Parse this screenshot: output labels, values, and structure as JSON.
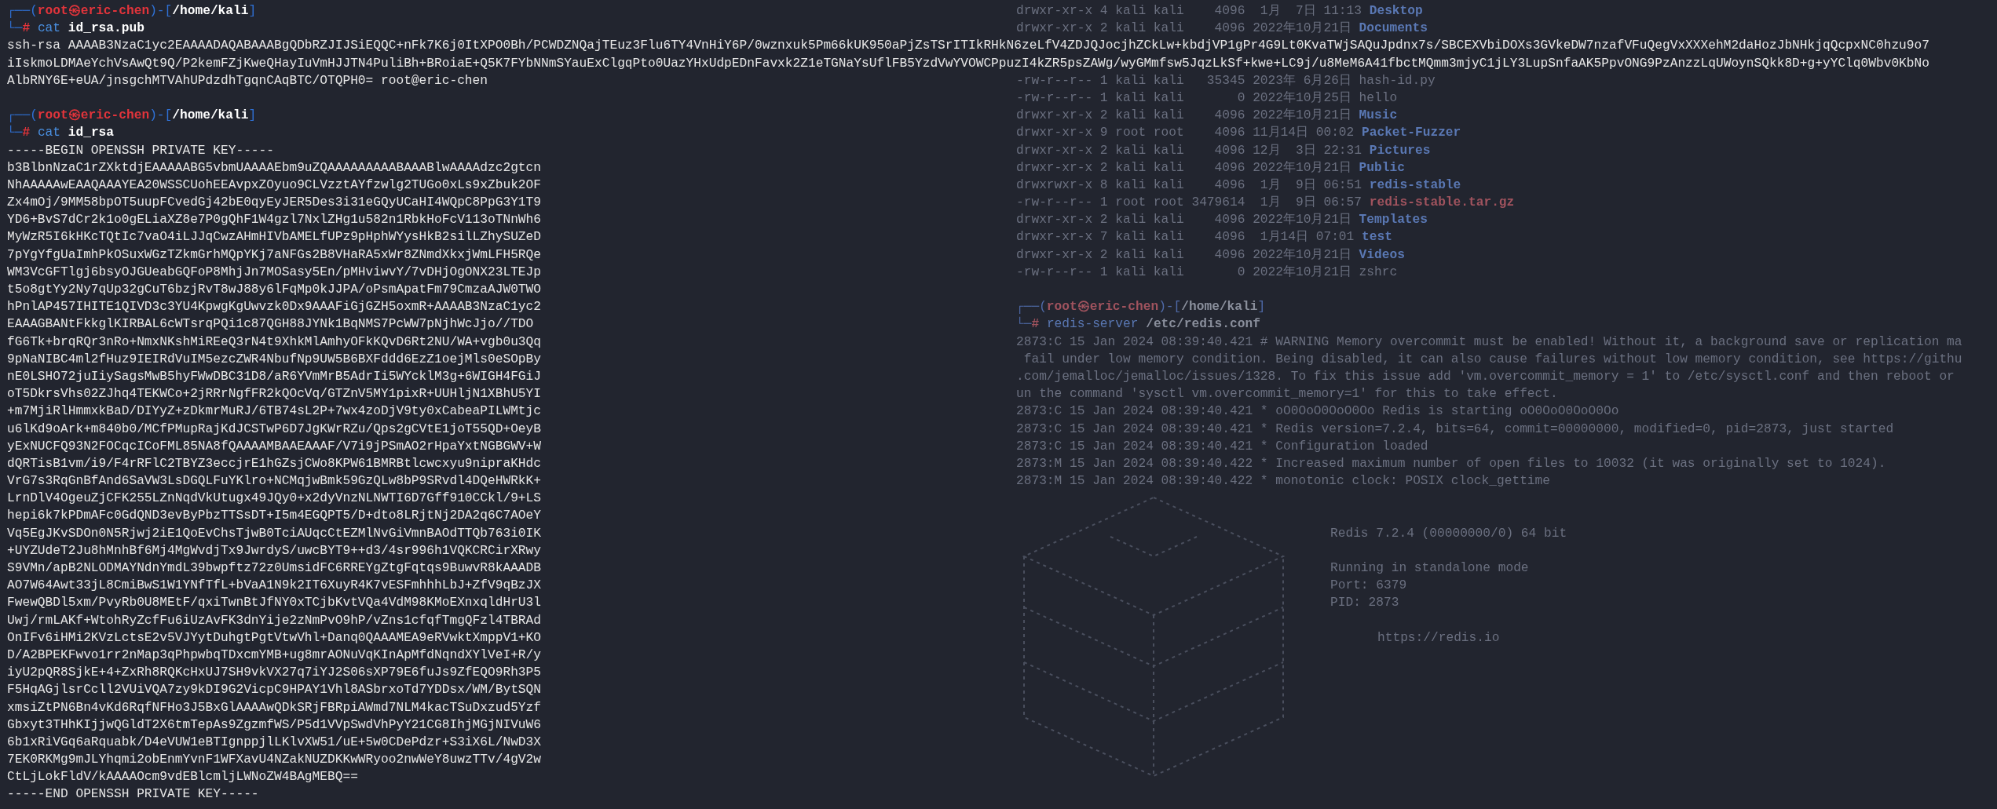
{
  "terminal": {
    "sessions": [
      {
        "prompt": {
          "frame_open": "┌──(",
          "user_host": "root㉿eric-chen",
          "frame_mid": ")-[",
          "path": "/home/kali",
          "frame_close": "]",
          "corner": "└─",
          "symbol": "#"
        },
        "command": {
          "program": "cat",
          "argument": "id_rsa.pub"
        },
        "output": [
          "ssh-rsa AAAAB3NzaC1yc2EAAAADAQABAAABgQDbRZJIJSiEQQC+nFk7K6j0ItXPO0Bh/PCWDZNQajTEuz3Flu6TY4VnHiY6P/0wznxuk5Pm66kUK950aPjZsTSrITIkRHkN6zeLfV4ZDJQJocjhZCkLw+kbdjVP1gPr4G9Lt0KvaTWjSAQuJpdnx7s/SBCEXVbiDOXs3GVkeDW7nzafVFuQegVxXXXehM2daHozJbNHkjqQcpxNC0hzu9o7",
          "iIskmoLDMAeYchVsAwQt9Q/P2kemFZjKweQHayIuVmHJJTN4PuliBh+BRoiaE+Q5K7FYbNNmSYauExClgqPto0UazYHxUdpEDnFavxk2Z1eTGNaYsUflFB5YzdVwYVOWCPpuzI4kZR5psZAWg/wyGMmfsw5JqzLkSf+kwe+LC9j/u8MeM6A41fbctMQmm3mjyC1jLY3LupSnfaAK5PpvONG9PzAnzzLqUWoynSQkk8D+g+yYClq0Wbv0KbNo",
          "AlbRNY6E+eUA/jnsgchMTVAhUPdzdhTgqnCAqBTC/OTQPH0= root@eric-chen"
        ]
      },
      {
        "prompt": {
          "frame_open": "┌──(",
          "user_host": "root㉿eric-chen",
          "frame_mid": ")-[",
          "path": "/home/kali",
          "frame_close": "]",
          "corner": "└─",
          "symbol": "#"
        },
        "command": {
          "program": "cat",
          "argument": "id_rsa"
        },
        "output": [
          "-----BEGIN OPENSSH PRIVATE KEY-----",
          "b3BlbnNzaC1rZXktdjEAAAAABG5vbmUAAAAEbm9uZQAAAAAAAAABAAABlwAAAAdzc2gtcn",
          "NhAAAAAwEAAQAAAYEA20WSSCUohEEAvpxZOyuo9CLVzztAYfzwlg2TUGo0xLs9xZbuk2OF",
          "Zx4mOj/9MM58bpOT5uupFCvedGj42bE0qyEyJER5Des3i31eGQyUCaHI4WQpC8PpG3Y1T9",
          "YD6+BvS7dCr2k1o0gELiaXZ8e7P0gQhF1W4gzl7NxlZHg1u582n1RbkHoFcV113oTNnWh6",
          "MyWzR5I6kHKcTQtIc7vaO4iLJJqCwzAHmHIVbAMELfUPz9pHphWYysHkB2silLZhySUZeD",
          "7pYgYfgUaImhPkOSuxWGzTZkmGrhMQpYKj7aNFGs2B8VHaRA5xWr8ZNmdXkxjWmLFH5RQe",
          "WM3VcGFTlgj6bsyOJGUeabGQFoP8MhjJn7MOSasy5En/pMHviwvY/7vDHjOgONX23LTEJp",
          "t5o8gtYy2Ny7qUp32gCuT6bzjRvT8wJ88y6lFqMp0kJJPA/oPsmApatFm79CmzaAJW0TWO",
          "hPnlAP457IHITE1QIVD3c3YU4KpwgKgUwvzk0Dx9AAAFiGjGZH5oxmR+AAAAB3NzaC1yc2",
          "EAAAGBANtFkkglKIRBAL6cWTsrqPQi1c87QGH88JYNk1BqNMS7PcWW7pNjhWcJjo//TDO",
          "fG6Tk+brqRQr3nRo+NmxNKshMiREeQ3rN4t9XhkMlAmhyOFkKQvD6Rt2NU/WA+vgb0u3Qq",
          "9pNaNIBC4ml2fHuz9IEIRdVuIM5ezcZWR4NbufNp9UW5B6BXFddd6EzZ1oejMls0eSOpBy",
          "nE0LSHO72juIiySagsMwB5hyFWwDBC31D8/aR6YVmMrB5AdrIi5WYcklM3g+6WIGH4FGiJ",
          "oT5DkrsVhs02ZJhq4TEKWCo+2jRRrNgfFR2kQOcVq/GTZnV5MY1pixR+UUHljN1XBhU5YI",
          "+m7MjiRlHmmxkBaD/DIYyZ+zDkmrMuRJ/6TB74sL2P+7wx4zoDjV9ty0xCabeaPILWMtjc",
          "u6lKd9oArk+m840b0/MCfPMupRajKdJCSTwP6D7JgKWrRZu/Qps2gCVtE1joT55QD+OeyB",
          "yExNUCFQ93N2FOCqcICoFML85NA8fQAAAAMBAAEAAAF/V7i9jPSmAO2rHpaYxtNGBGWV+W",
          "dQRTisB1vm/i9/F4rRFlC2TBYZ3eccjrE1hGZsjCWo8KPW61BMRBtlcwcxyu9nipraKHdc",
          "VrG7s3RqGnBfAnd6SaVW3LsDGQLFuYKlro+NCMqjwBmk59GzQLw8bP9SRvdl4DQeHWRkK+",
          "LrnDlV4OgeuZjCFK255LZnNqdVkUtugx49JQy0+x2dyVnzNLNWTI6D7Gff910CCkl/9+LS",
          "hepi6k7kPDmAFc0GdQND3evByPbzTTSsDT+I5m4EGQPT5/D+dto8LRjtNj2DA2q6C7AOeY",
          "Vq5EgJKvSDOn0N5Rjwj2iE1QoEvChsTjwB0TciAUqcCtEZMlNvGiVmnBAOdTTQb763i0IK",
          "+UYZUdeT2Ju8hMnhBf6Mj4MgWvdjTx9JwrdyS/uwcBYT9++d3/4sr996h1VQKCRCirXRwy",
          "S9VMn/apB2NLODMAYNdnYmdL39bwpftz72z0UmsidFC6RREYgZtgFqtqs9BuwvR8kAAADB",
          "AO7W64Awt33jL8CmiBwS1W1YNfTfL+bVaA1N9k2IT6XuyR4K7vESFmhhhLbJ+ZfV9qBzJX",
          "FwewQBDl5xm/PvyRb0U8MEtF/qxiTwnBtJfNY0xTCjbKvtVQa4VdM98KMoEXnxqldHrU3l",
          "Uwj/rmLAKf+WtohRyZcfFu6iUzAvFK3dnYije2zNmPvO9hP/vZns1cfqfTmgQFzl4TBRAd",
          "OnIFv6iHMi2KVzLctsE2v5VJYytDuhgtPgtVtwVhl+Danq0QAAAMEA9eRVwktXmppV1+KO",
          "D/A2BPEKFwvo1rr2nMap3qPhpwbqTDxcmYMB+ug8mrAONuVqKInApMfdNqndXYlVeI+R/y",
          "iyU2pQR8SjkE+4+ZxRh8RQKcHxUJ7SH9vkVX27q7iYJ2S06sXP79E6fuJs9ZfEQO9Rh3P5",
          "F5HqAGjlsrCcll2VUiVQA7zy9kDI9G2VicpC9HPAY1Vhl8ASbrxoTd7YDDsx/WM/BytSQN",
          "xmsiZtPN6Bn4vKd6RqfNFHo3J5BxGlAAAAwQDkSRjFBRpiAWmd7NLM4kacTSuDxzud5Yzf",
          "Gbxyt3THhKIjjwQGldT2X6tmTepAs9ZgzmfWS/P5d1VVpSwdVhPyY21CG8IhjMGjNIVuW6",
          "6b1xRiVGq6aRquabk/D4eVUW1eBTIgnppjlLKlvXW51/uE+5w0CDePdzr+S3iX6L/NwD3X",
          "7EK0RKMg9mJLYhqmi2obEnmYvnF1WFXavU4NZakNUZDKKwWRyoo2nwWeY8uwzTTv/4gV2w",
          "CtLjLokFldV/kAAAAOcm9vdEBlcmljLWNoZW4BAgMEBQ==",
          "-----END OPENSSH PRIVATE KEY-----"
        ]
      }
    ]
  },
  "background_window": {
    "listing_top": [
      {
        "info": "drwxr-xr-x 4 kali kali    4096  1月  7日 11:13",
        "name": "Desktop",
        "kind": "dir"
      },
      {
        "info": "drwxr-xr-x 2 kali kali    4096 2022年10月21日",
        "name": "Documents",
        "kind": "dir"
      }
    ],
    "listing_rest": [
      {
        "info": "-rw-r--r-- 1 kali kali   35345 2023年 6月26日",
        "name": "hash-id.py",
        "kind": "file"
      },
      {
        "info": "-rw-r--r-- 1 kali kali       0 2022年10月25日",
        "name": "hello",
        "kind": "file"
      },
      {
        "info": "drwxr-xr-x 2 kali kali    4096 2022年10月21日",
        "name": "Music",
        "kind": "dir"
      },
      {
        "info": "drwxr-xr-x 9 root root    4096 11月14日 00:02",
        "name": "Packet-Fuzzer",
        "kind": "dir"
      },
      {
        "info": "drwxr-xr-x 2 kali kali    4096 12月  3日 22:31",
        "name": "Pictures",
        "kind": "dir"
      },
      {
        "info": "drwxr-xr-x 2 kali kali    4096 2022年10月21日",
        "name": "Public",
        "kind": "dir"
      },
      {
        "info": "drwxrwxr-x 8 kali kali    4096  1月  9日 06:51",
        "name": "redis-stable",
        "kind": "dir"
      },
      {
        "info": "-rw-r--r-- 1 root root 3479614  1月  9日 06:57",
        "name": "redis-stable.tar.gz",
        "kind": "archive"
      },
      {
        "info": "drwxr-xr-x 2 kali kali    4096 2022年10月21日",
        "name": "Templates",
        "kind": "dir"
      },
      {
        "info": "drwxr-xr-x 7 kali kali    4096  1月14日 07:01",
        "name": "test",
        "kind": "dir"
      },
      {
        "info": "drwxr-xr-x 2 kali kali    4096 2022年10月21日",
        "name": "Videos",
        "kind": "dir"
      },
      {
        "info": "-rw-r--r-- 1 kali kali       0 2022年10月21日",
        "name": "zshrc",
        "kind": "file"
      }
    ],
    "prompt": {
      "frame_open": "┌──(",
      "user_host": "root㉿eric-chen",
      "frame_mid": ")-[",
      "path": "/home/kali",
      "frame_close": "]",
      "corner": "└─",
      "symbol": "#"
    },
    "command": {
      "program": "redis-server",
      "argument": "/etc/redis.conf"
    },
    "log": [
      "2873:C 15 Jan 2024 08:39:40.421 # WARNING Memory overcommit must be enabled! Without it, a background save or replication ma",
      " fail under low memory condition. Being disabled, it can also cause failures without low memory condition, see https://githu",
      ".com/jemalloc/jemalloc/issues/1328. To fix this issue add 'vm.overcommit_memory = 1' to /etc/sysctl.conf and then reboot or",
      "un the command 'sysctl vm.overcommit_memory=1' for this to take effect.",
      "2873:C 15 Jan 2024 08:39:40.421 * oO0OoO0OoO0Oo Redis is starting oO0OoO0OoO0Oo",
      "2873:C 15 Jan 2024 08:39:40.421 * Redis version=7.2.4, bits=64, commit=00000000, modified=0, pid=2873, just started",
      "2873:C 15 Jan 2024 08:39:40.421 * Configuration loaded",
      "2873:M 15 Jan 2024 08:39:40.422 * Increased maximum number of open files to 10032 (it was originally set to 1024).",
      "2873:M 15 Jan 2024 08:39:40.422 * monotonic clock: POSIX clock_gettime"
    ],
    "banner": {
      "groups": [
        [
          "Redis 7.2.4 (00000000/0) 64 bit"
        ],
        [
          "Running in standalone mode",
          "Port: 6379",
          "PID: 2873"
        ],
        [
          "https://redis.io"
        ]
      ]
    }
  }
}
